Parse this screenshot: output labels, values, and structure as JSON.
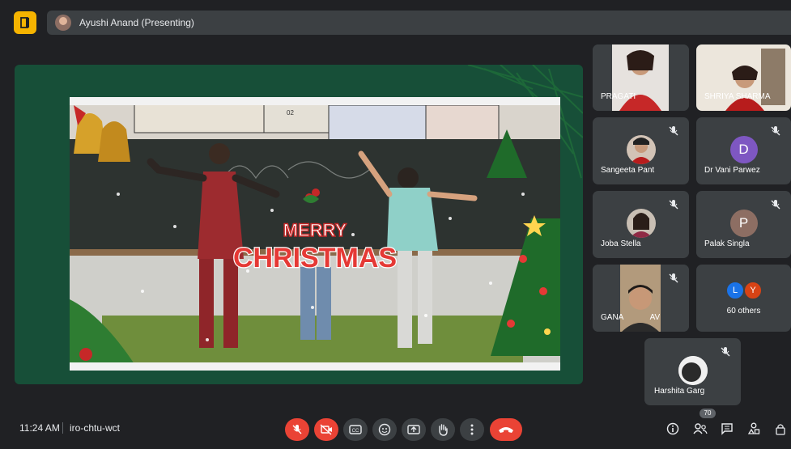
{
  "presenting": {
    "label": "Ayushi Anand (Presenting)"
  },
  "video": {
    "overlay_top": "MERRY",
    "overlay_bottom": "CHRISTMAS",
    "board_text": "02"
  },
  "participants": [
    {
      "name": "PRAGATI",
      "muted": false,
      "kind": "video"
    },
    {
      "name": "SHRIYA SHARMA",
      "muted": false,
      "kind": "video"
    },
    {
      "name": "Sangeeta Pant",
      "muted": true,
      "kind": "photo"
    },
    {
      "name": "Dr Vani Parwez",
      "muted": true,
      "kind": "letter",
      "letter": "D",
      "color": "#7e57c2"
    },
    {
      "name": "Joba Stella",
      "muted": true,
      "kind": "photo"
    },
    {
      "name": "Palak Singla",
      "muted": true,
      "kind": "letter",
      "letter": "P",
      "color": "#8d6e63"
    },
    {
      "name": "GANA",
      "suffix": "AV",
      "muted": true,
      "kind": "video"
    },
    {
      "name": "Harshita Garg",
      "muted": true,
      "kind": "photo"
    }
  ],
  "others": {
    "label": "60 others",
    "avatars": [
      {
        "letter": "L",
        "color": "#1a73e8"
      },
      {
        "letter": "Y",
        "color": "#d84315"
      }
    ]
  },
  "bottom": {
    "time": "11:24 AM",
    "meeting_code": "iro-chtu-wct",
    "people_count": "70"
  }
}
